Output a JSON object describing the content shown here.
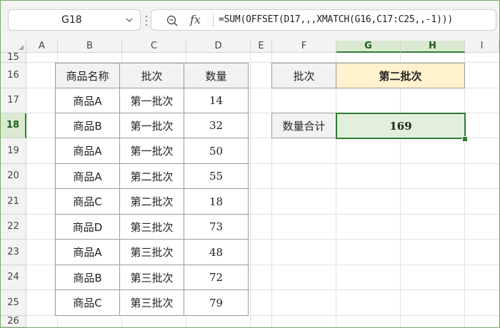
{
  "formula_bar": {
    "name_box": "G18",
    "fx_label": "fx",
    "formula": "=SUM(OFFSET(D17,,,XMATCH(G16,C17:C25,,-1)))"
  },
  "columns": [
    "A",
    "B",
    "C",
    "D",
    "E",
    "F",
    "G",
    "H",
    "I"
  ],
  "rows": [
    "15",
    "16",
    "17",
    "18",
    "19",
    "20",
    "21",
    "22",
    "23",
    "24",
    "25",
    "26"
  ],
  "selected_cell": "G18",
  "table": {
    "headers": [
      "商品名称",
      "批次",
      "数量"
    ],
    "rows": [
      [
        "商品A",
        "第一批次",
        "14"
      ],
      [
        "商品B",
        "第一批次",
        "32"
      ],
      [
        "商品A",
        "第一批次",
        "50"
      ],
      [
        "商品A",
        "第二批次",
        "55"
      ],
      [
        "商品C",
        "第二批次",
        "18"
      ],
      [
        "商品D",
        "第三批次",
        "73"
      ],
      [
        "商品A",
        "第三批次",
        "48"
      ],
      [
        "商品B",
        "第三批次",
        "72"
      ],
      [
        "商品C",
        "第三批次",
        "79"
      ]
    ]
  },
  "lookup": {
    "batch_label": "批次",
    "batch_value": "第二批次",
    "sum_label": "数量合计",
    "sum_value": "169"
  },
  "colors": {
    "selection_green": "#2e7d32",
    "input_yellow": "#fff2cc",
    "result_green": "#e2efda"
  }
}
